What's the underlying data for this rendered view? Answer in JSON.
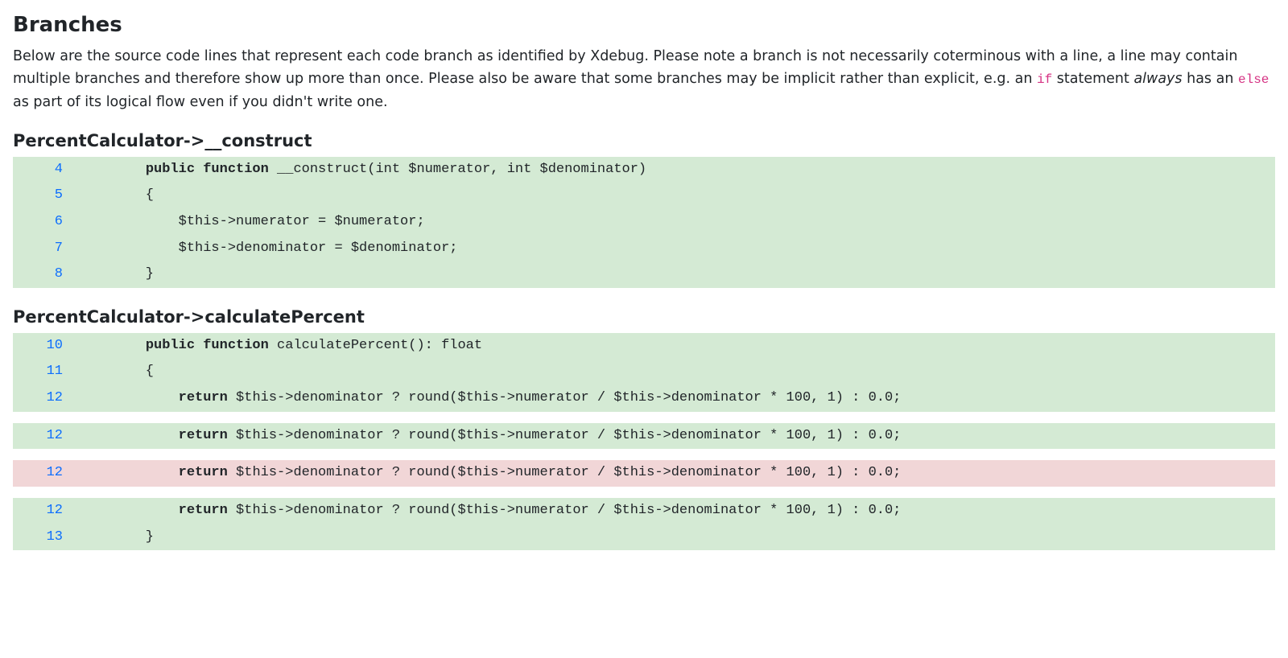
{
  "heading": "Branches",
  "intro": {
    "p1": "Below are the source code lines that represent each code branch as identified by Xdebug. Please note a branch is not necessarily coterminous with a line, a line may contain multiple branches and therefore show up more than once. Please also be aware that some branches may be implicit rather than explicit, e.g. an ",
    "kw_if": "if",
    "p2": " statement ",
    "always": "always",
    "p3": " has an ",
    "kw_else": "else",
    "p4": " as part of its logical flow even if you didn't write one."
  },
  "methods": [
    {
      "title": "PercentCalculator->__construct",
      "groups": [
        {
          "coverage": "covered",
          "lines": [
            {
              "n": "4",
              "tokens": [
                {
                  "t": "    ",
                  "c": ""
                },
                {
                  "t": "public function",
                  "c": "kw"
                },
                {
                  "t": " __construct(int $numerator, int $denominator)",
                  "c": ""
                }
              ]
            },
            {
              "n": "5",
              "tokens": [
                {
                  "t": "    {",
                  "c": ""
                }
              ]
            },
            {
              "n": "6",
              "tokens": [
                {
                  "t": "        $this->numerator = $numerator;",
                  "c": ""
                }
              ]
            },
            {
              "n": "7",
              "tokens": [
                {
                  "t": "        $this->denominator = $denominator;",
                  "c": ""
                }
              ]
            },
            {
              "n": "8",
              "tokens": [
                {
                  "t": "    }",
                  "c": ""
                }
              ]
            }
          ]
        }
      ]
    },
    {
      "title": "PercentCalculator->calculatePercent",
      "groups": [
        {
          "coverage": "covered",
          "lines": [
            {
              "n": "10",
              "tokens": [
                {
                  "t": "    ",
                  "c": ""
                },
                {
                  "t": "public function",
                  "c": "kw"
                },
                {
                  "t": " calculatePercent(): float",
                  "c": ""
                }
              ]
            },
            {
              "n": "11",
              "tokens": [
                {
                  "t": "    {",
                  "c": ""
                }
              ]
            },
            {
              "n": "12",
              "tokens": [
                {
                  "t": "        ",
                  "c": ""
                },
                {
                  "t": "return",
                  "c": "kw"
                },
                {
                  "t": " $this->denominator ? round($this->numerator / $this->denominator * 100, 1) : 0.0;",
                  "c": ""
                }
              ]
            }
          ]
        },
        {
          "coverage": "covered",
          "lines": [
            {
              "n": "12",
              "tokens": [
                {
                  "t": "        ",
                  "c": ""
                },
                {
                  "t": "return",
                  "c": "kw"
                },
                {
                  "t": " $this->denominator ? round($this->numerator / $this->denominator * 100, 1) : 0.0;",
                  "c": ""
                }
              ]
            }
          ]
        },
        {
          "coverage": "uncovered",
          "lines": [
            {
              "n": "12",
              "tokens": [
                {
                  "t": "        ",
                  "c": ""
                },
                {
                  "t": "return",
                  "c": "kw"
                },
                {
                  "t": " $this->denominator ? round($this->numerator / $this->denominator * 100, 1) : 0.0;",
                  "c": ""
                }
              ]
            }
          ]
        },
        {
          "coverage": "covered",
          "lines": [
            {
              "n": "12",
              "tokens": [
                {
                  "t": "        ",
                  "c": ""
                },
                {
                  "t": "return",
                  "c": "kw"
                },
                {
                  "t": " $this->denominator ? round($this->numerator / $this->denominator * 100, 1) : 0.0;",
                  "c": ""
                }
              ]
            },
            {
              "n": "13",
              "tokens": [
                {
                  "t": "    }",
                  "c": ""
                }
              ]
            }
          ]
        }
      ]
    }
  ]
}
